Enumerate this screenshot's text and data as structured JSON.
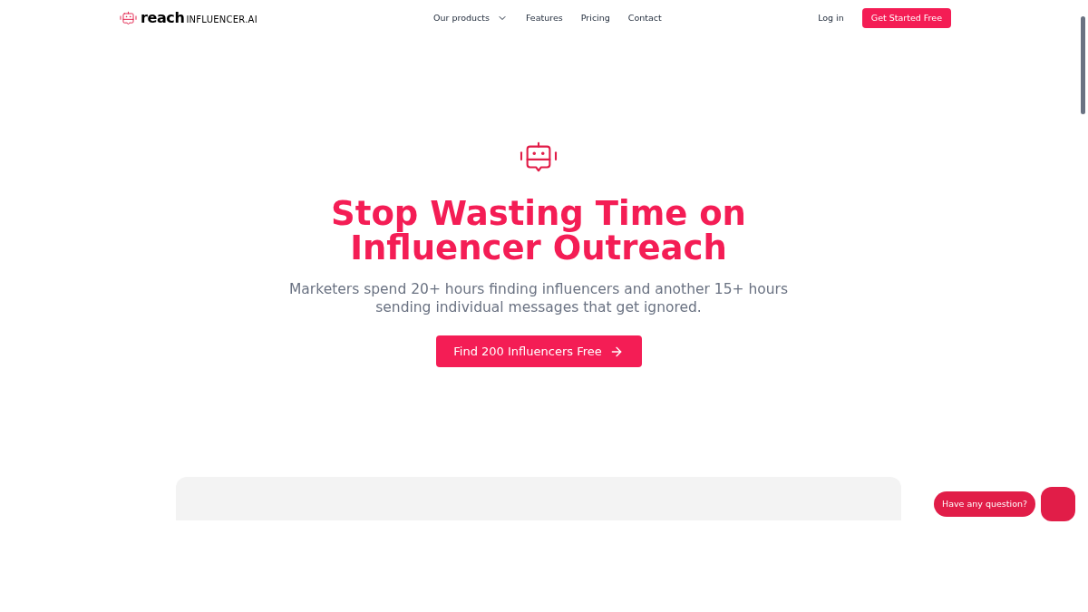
{
  "nav": {
    "logo_bold": "reach",
    "logo_rest": "INFLUENCER.AI",
    "links": [
      {
        "label": "Our products",
        "dropdown": true
      },
      {
        "label": "Features",
        "dropdown": false
      },
      {
        "label": "Pricing",
        "dropdown": false
      },
      {
        "label": "Contact",
        "dropdown": false
      }
    ],
    "login": "Log in",
    "cta": "Get Started Free"
  },
  "hero": {
    "title_lines": [
      "Stop Wasting Time on",
      "Influencer Outreach"
    ],
    "subtitle": "Marketers spend 20+ hours finding influencers and another 15+ hours sending individual messages that get ignored.",
    "button": "Find 200 Influencers Free"
  },
  "chat": {
    "bubble": "Have any question?"
  }
}
